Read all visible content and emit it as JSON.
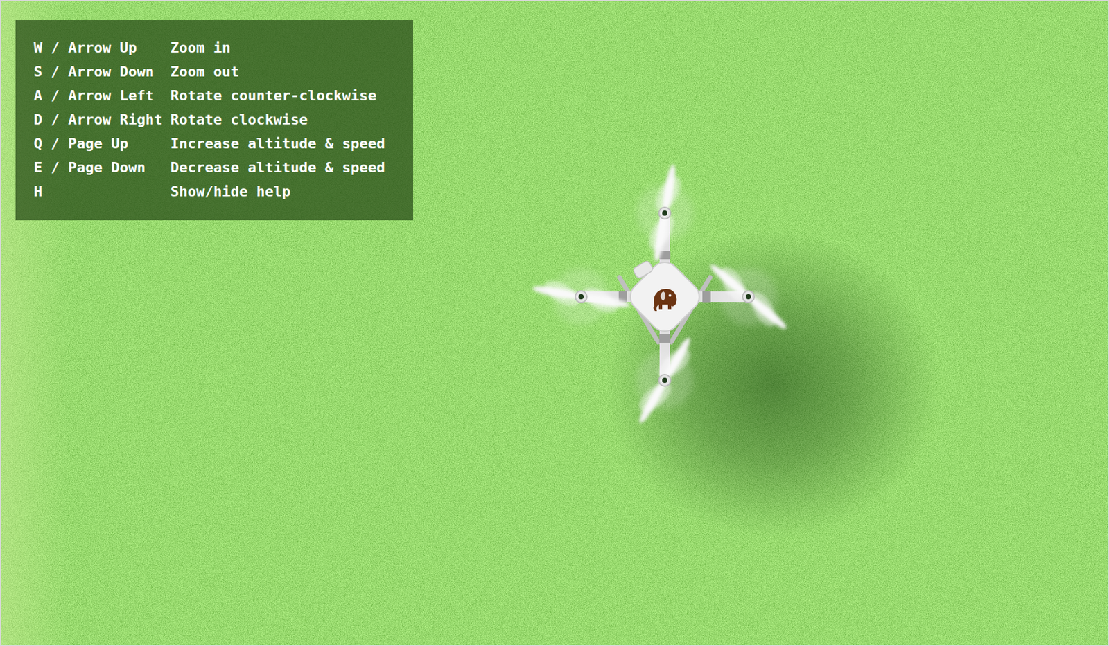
{
  "help": {
    "visible": true,
    "entries": [
      {
        "keys": "W / Arrow Up",
        "action": "Zoom in"
      },
      {
        "keys": "S / Arrow Down",
        "action": "Zoom out"
      },
      {
        "keys": "A / Arrow Left",
        "action": "Rotate counter-clockwise"
      },
      {
        "keys": "D / Arrow Right",
        "action": "Rotate clockwise"
      },
      {
        "keys": "Q / Page Up",
        "action": "Increase altitude & speed"
      },
      {
        "keys": "E / Page Down",
        "action": "Decrease altitude & speed"
      },
      {
        "keys": "H",
        "action": "Show/hide help"
      }
    ]
  }
}
